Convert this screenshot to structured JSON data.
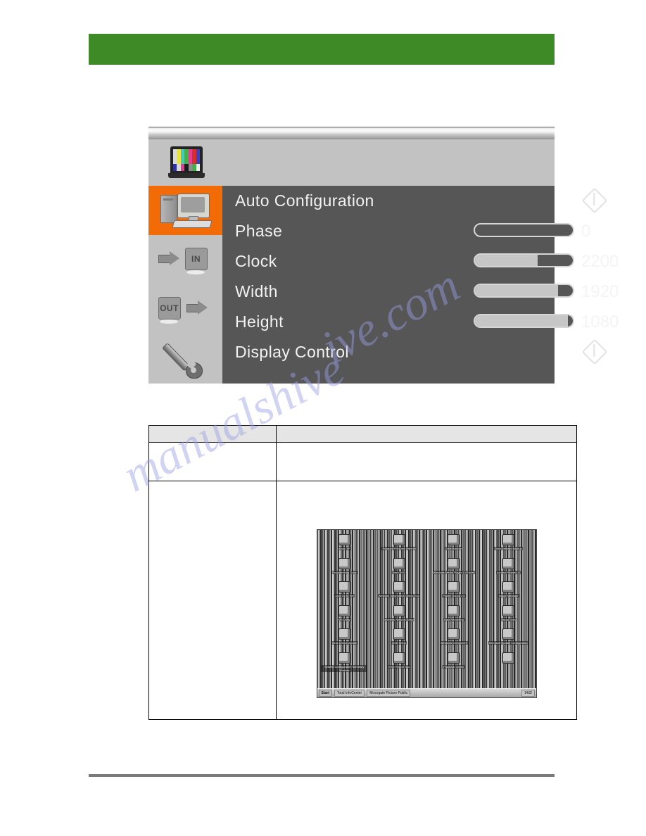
{
  "page": {
    "header_band_title": "",
    "watermark_left": "manualshive",
    "watermark_right": "ive.com"
  },
  "osd": {
    "title_icon": "color-bars-monitor-icon",
    "sidebar": [
      {
        "id": "computer",
        "icon": "computer-icon",
        "label": "",
        "selected": true
      },
      {
        "id": "input",
        "icon": "input-arrow-icon",
        "label": "IN",
        "selected": false
      },
      {
        "id": "output",
        "icon": "output-arrow-icon",
        "label": "OUT",
        "selected": false
      },
      {
        "id": "tools",
        "icon": "wrench-icon",
        "label": "",
        "selected": false
      }
    ],
    "accent_color": "#f36b07",
    "panel_bg": "#565656",
    "rail_bg": "#c2c2c2",
    "rows": [
      {
        "label": "Auto Configuration",
        "type": "action",
        "value": "",
        "fill": 0,
        "icon": "enter-diamond-icon"
      },
      {
        "label": "Phase",
        "type": "slider",
        "value": "0",
        "fill": 0,
        "icon": ""
      },
      {
        "label": "Clock",
        "type": "slider",
        "value": "2200",
        "fill": 64,
        "icon": ""
      },
      {
        "label": "Width",
        "type": "slider",
        "value": "1920",
        "fill": 85,
        "icon": ""
      },
      {
        "label": "Height",
        "type": "slider",
        "value": "1080",
        "fill": 95,
        "icon": ""
      },
      {
        "label": "Display Control",
        "type": "action",
        "value": "",
        "fill": 0,
        "icon": "enter-diamond-icon"
      }
    ]
  },
  "table": {
    "header": {
      "col_a": "",
      "col_b": ""
    },
    "rows": [
      {
        "col_a": "",
        "col_b": ""
      },
      {
        "col_a": "",
        "col_b": ""
      }
    ]
  },
  "desktop_screenshot": {
    "icons": [
      "About XP",
      "Program Files and Internet",
      "Date Backup",
      "Data Settings Backup",
      "Programming Tools",
      "Nero DVD",
      "Windows Media Player 10 Folder",
      "Acrobat Reader 10",
      "Java Up to Set",
      "Network Diagnostics Check Tool",
      "Pocket Sound 2.5",
      "Image Manager",
      "MS Utility",
      "Wireless Network Setup",
      "Data Recording",
      "Visual Tools",
      "Virus Check Update",
      "USB Setup",
      "Windows Component",
      "Microsoft Update Configuration",
      "System Configuration Summary Window",
      "Error Report Tool",
      "Playback Center"
    ],
    "taskbar": {
      "start": "Start",
      "buttons": [
        "Total InfoCenter",
        "Microgate Picture Public"
      ],
      "clock": "14:02"
    }
  }
}
